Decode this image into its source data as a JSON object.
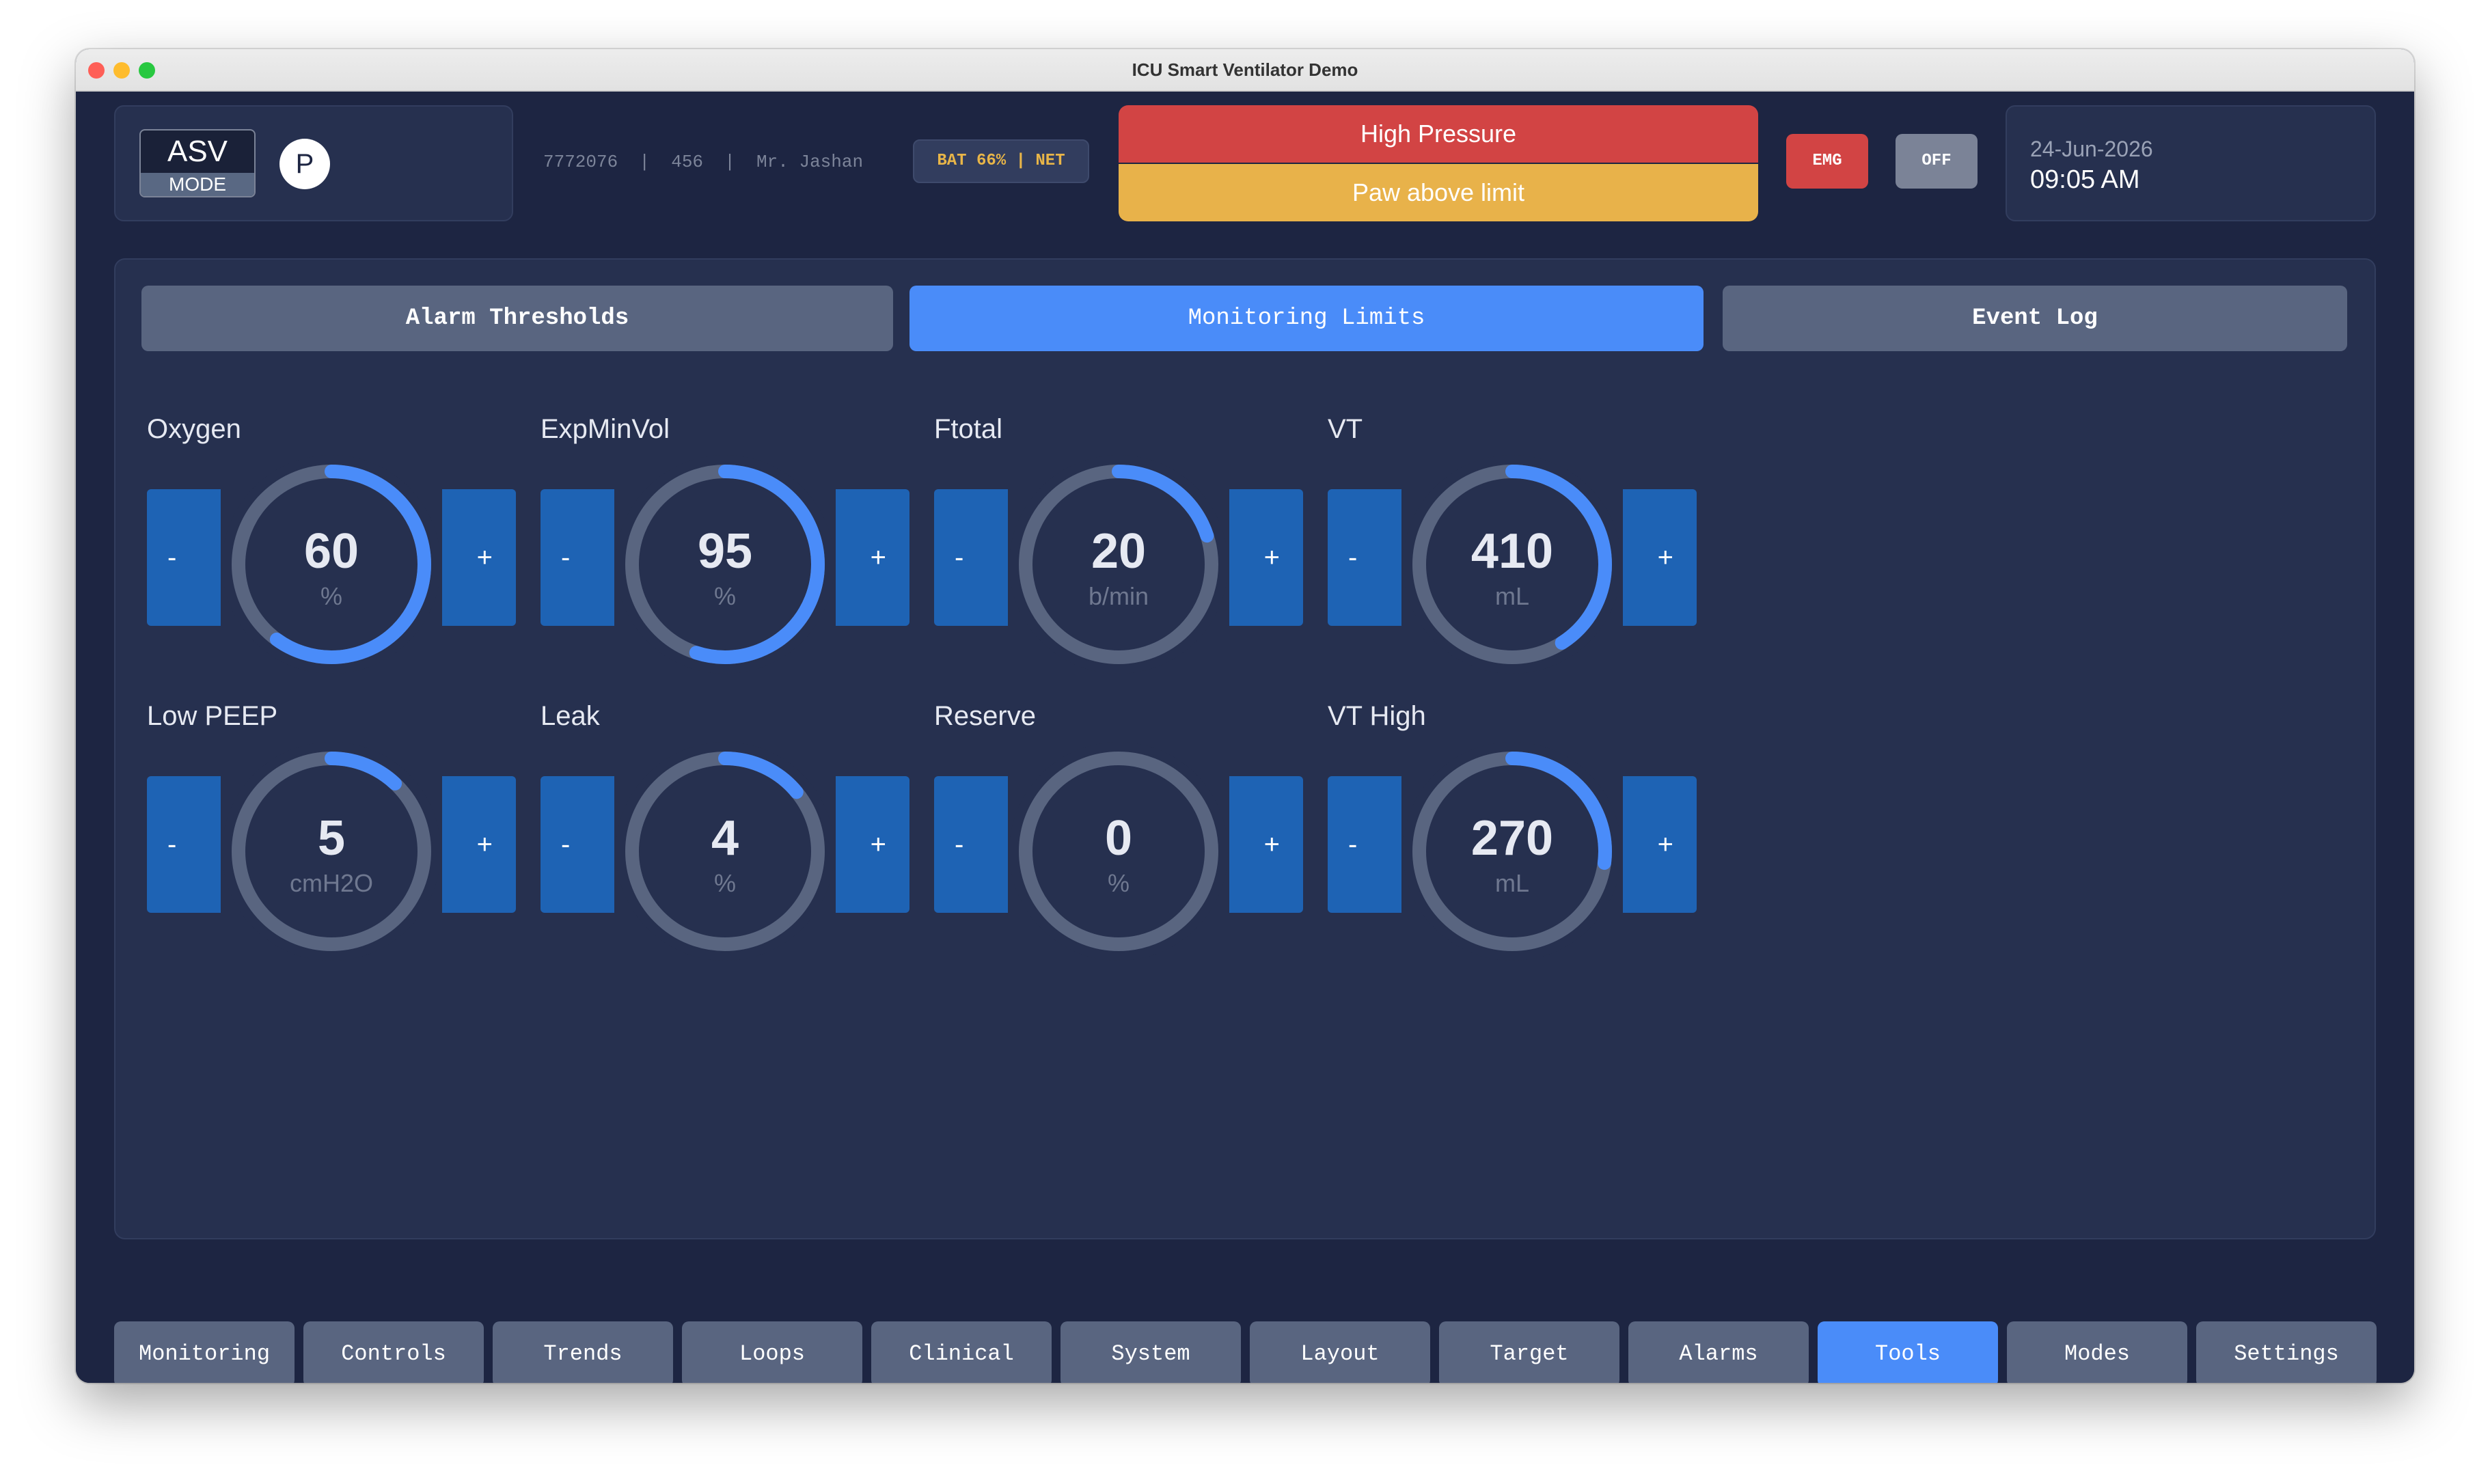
{
  "window": {
    "title": "ICU Smart Ventilator Demo"
  },
  "header": {
    "mode": {
      "name": "ASV",
      "label": "MODE",
      "badge": "P"
    },
    "patient_line": "7772076  |  456  |  Mr. Jashan",
    "status": "BAT 66% | NET",
    "alarms": {
      "primary": "High Pressure",
      "secondary": "Paw above limit"
    },
    "emg_label": "EMG",
    "off_label": "OFF",
    "date": "24-Jun-2026",
    "time": "09:05 AM"
  },
  "tabs": [
    {
      "label": "Alarm Thresholds",
      "active": false
    },
    {
      "label": "Monitoring Limits",
      "active": true
    },
    {
      "label": "Event Log",
      "active": false
    }
  ],
  "gauges": [
    {
      "label": "Oxygen",
      "value": "60",
      "unit": "%",
      "fill_fraction": 0.6
    },
    {
      "label": "ExpMinVol",
      "value": "95",
      "unit": "%",
      "fill_fraction": 0.55
    },
    {
      "label": "Ftotal",
      "value": "20",
      "unit": "b/min",
      "fill_fraction": 0.2
    },
    {
      "label": "VT",
      "value": "410",
      "unit": "mL",
      "fill_fraction": 0.41
    },
    {
      "label": "Low PEEP",
      "value": "5",
      "unit": "cmH2O",
      "fill_fraction": 0.12
    },
    {
      "label": "Leak",
      "value": "4",
      "unit": "%",
      "fill_fraction": 0.14
    },
    {
      "label": "Reserve",
      "value": "0",
      "unit": "%",
      "fill_fraction": 0
    },
    {
      "label": "VT High",
      "value": "270",
      "unit": "mL",
      "fill_fraction": 0.27
    }
  ],
  "stepper": {
    "minus": "-",
    "plus": "+"
  },
  "nav": [
    {
      "label": "Monitoring",
      "active": false
    },
    {
      "label": "Controls",
      "active": false
    },
    {
      "label": "Trends",
      "active": false
    },
    {
      "label": "Loops",
      "active": false
    },
    {
      "label": "Clinical",
      "active": false
    },
    {
      "label": "System",
      "active": false
    },
    {
      "label": "Layout",
      "active": false
    },
    {
      "label": "Target",
      "active": false
    },
    {
      "label": "Alarms",
      "active": false
    },
    {
      "label": "Tools",
      "active": true
    },
    {
      "label": "Modes",
      "active": false
    },
    {
      "label": "Settings",
      "active": false
    }
  ],
  "colors": {
    "background": "#1d2542",
    "panel": "#26304f",
    "accent": "#4a8cf9",
    "alarm_red": "#d24444",
    "alarm_yellow": "#e8b24a",
    "stepper_blue": "#1e63b4",
    "ring_track": "#596580"
  }
}
